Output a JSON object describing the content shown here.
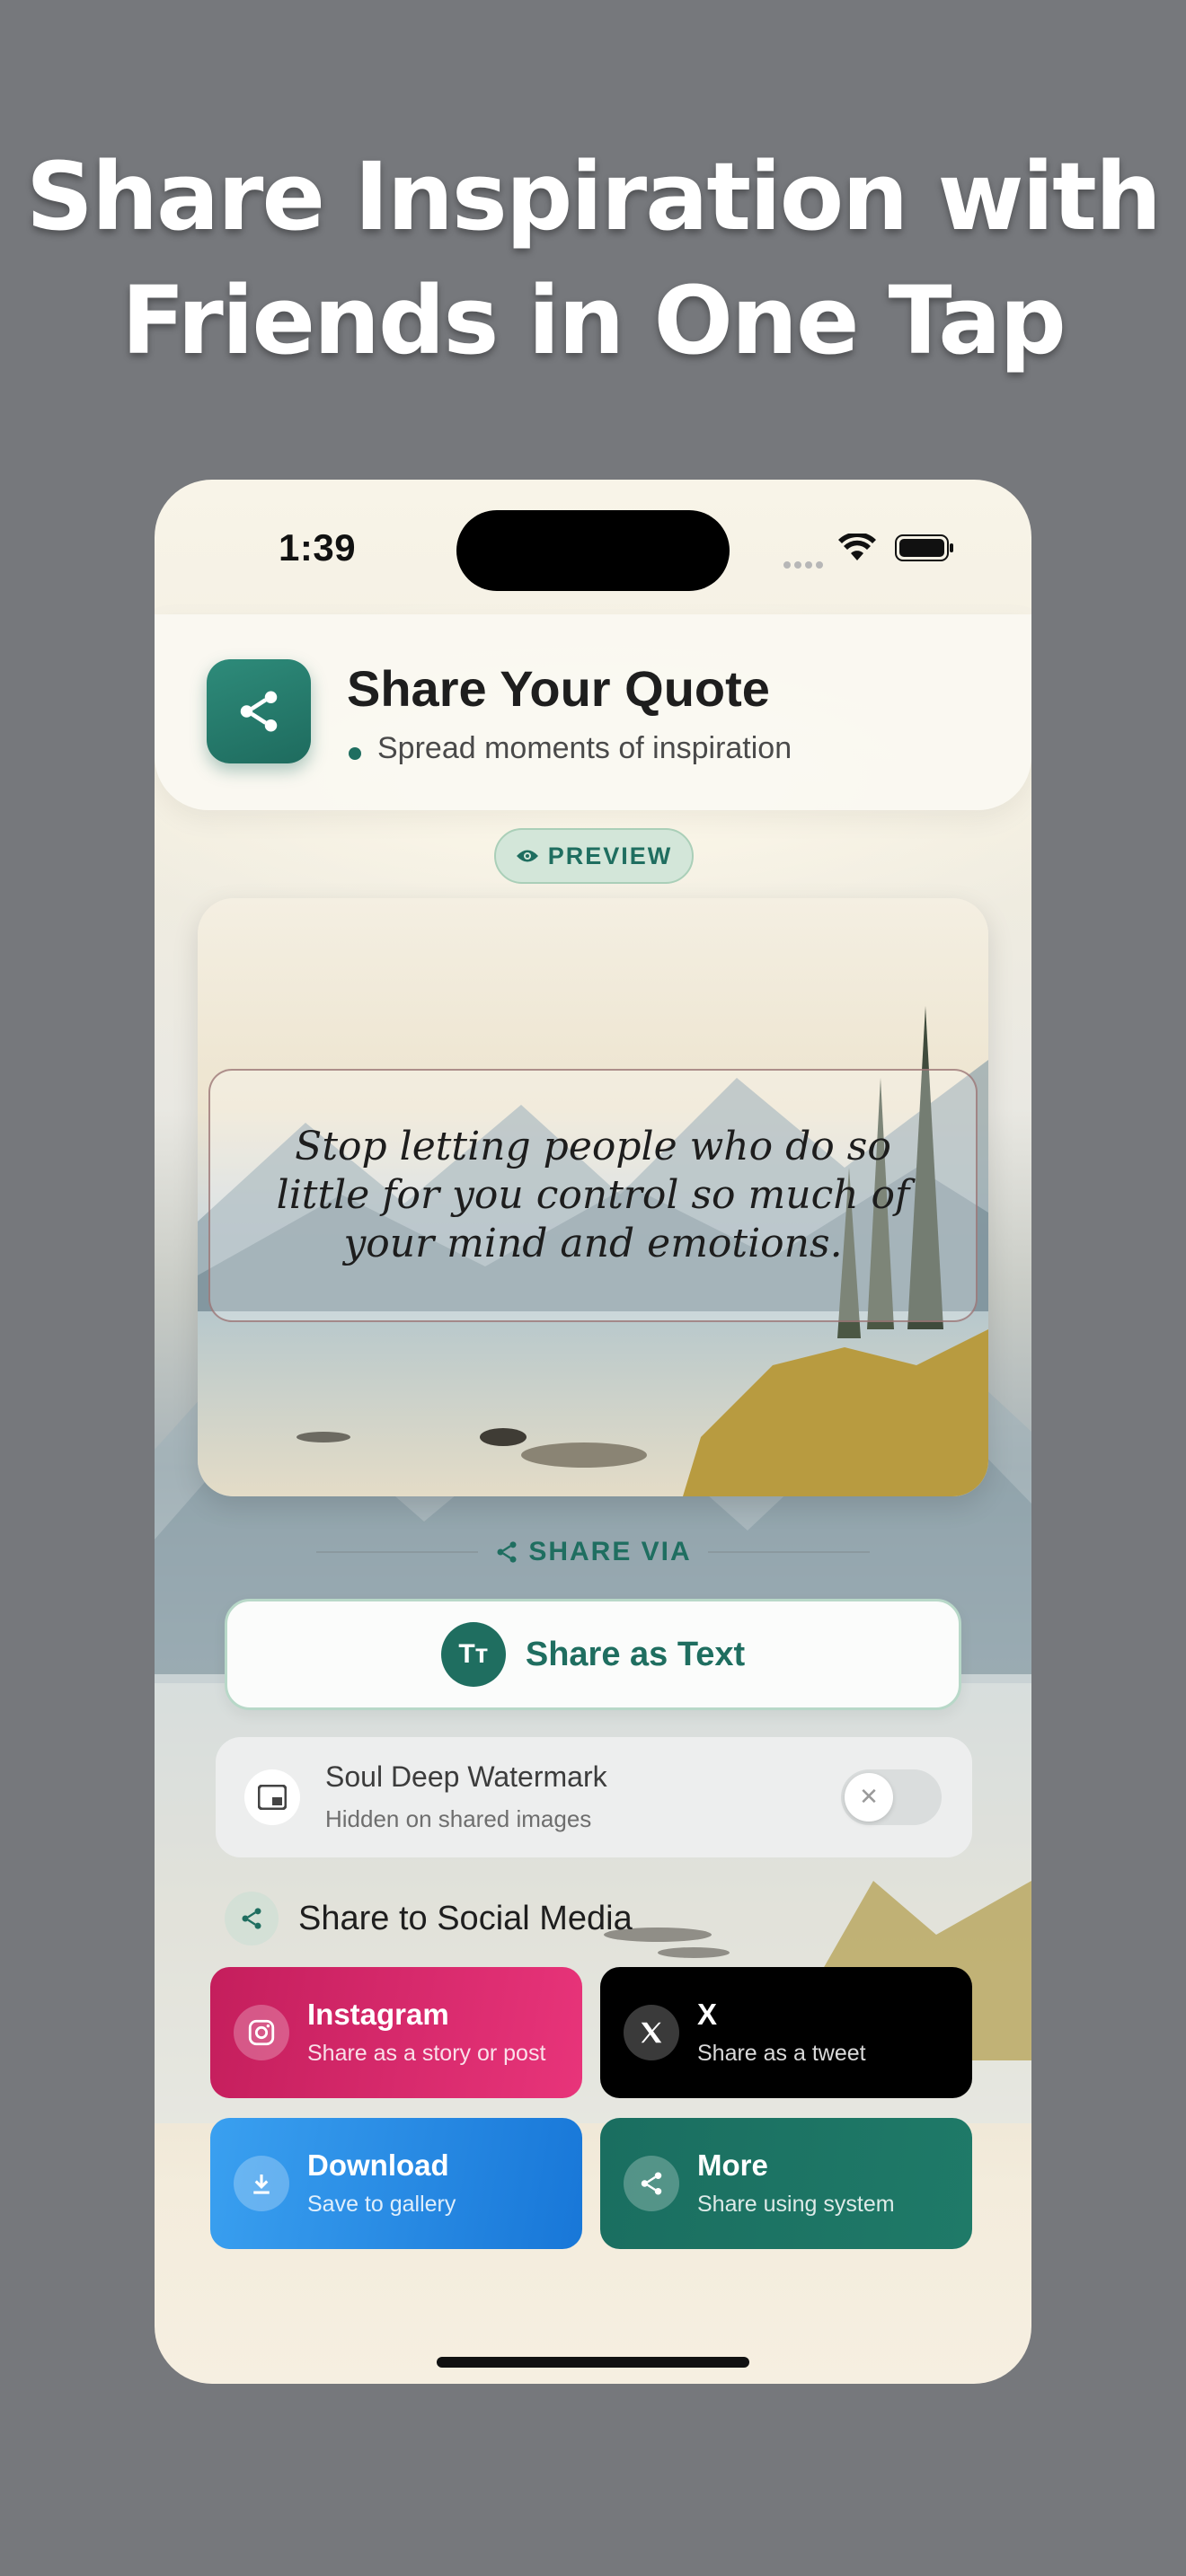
{
  "headline": {
    "line1": "Share Inspiration with",
    "line2": "Friends in One Tap"
  },
  "status_bar": {
    "time": "1:39"
  },
  "header": {
    "title": "Share Your Quote",
    "subtitle": "Spread moments of inspiration",
    "icon": "share-icon"
  },
  "preview_badge": {
    "label": "PREVIEW",
    "icon": "eye-icon"
  },
  "quote": {
    "text": "Stop letting people who do so little for you control so much of your mind and emotions."
  },
  "share_via": {
    "label": "SHARE VIA"
  },
  "share_text_button": {
    "label": "Share as Text",
    "icon_text": "Tт"
  },
  "watermark": {
    "title": "Soul Deep Watermark",
    "subtitle": "Hidden on shared images",
    "toggle_on": false
  },
  "social": {
    "title": "Share to Social Media",
    "tiles": [
      {
        "title": "Instagram",
        "subtitle": "Share as a story or post",
        "icon": "instagram-icon",
        "color": "#d62a6a"
      },
      {
        "title": "X",
        "subtitle": "Share as a tweet",
        "icon": "x-icon",
        "color": "#000000"
      },
      {
        "title": "Download",
        "subtitle": "Save to gallery",
        "icon": "download-icon",
        "color": "#2a8be4"
      },
      {
        "title": "More",
        "subtitle": "Share using system",
        "icon": "share-icon",
        "color": "#1d7464"
      }
    ]
  },
  "colors": {
    "accent": "#1f6e60",
    "background": "#76787c"
  }
}
